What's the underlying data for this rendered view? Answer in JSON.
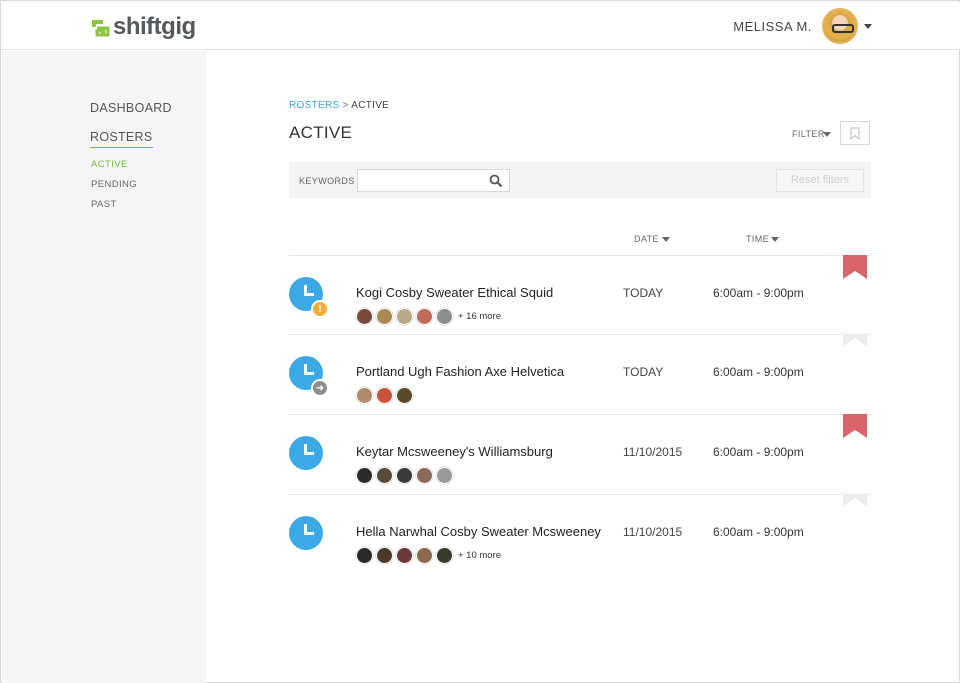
{
  "header": {
    "logo_text": "shiftgig",
    "user_name": "MELISSA M."
  },
  "sidebar": {
    "items": [
      {
        "label": "DASHBOARD"
      },
      {
        "label": "ROSTERS"
      }
    ],
    "sub_items": [
      {
        "label": "ACTIVE",
        "selected": true
      },
      {
        "label": "PENDING",
        "selected": false
      },
      {
        "label": "PAST",
        "selected": false
      }
    ]
  },
  "main": {
    "breadcrumb": {
      "link": "ROSTERS",
      "separator": ">",
      "current": "ACTIVE"
    },
    "title": "ACTIVE",
    "filter_label": "FILTER",
    "keywords_label": "KEYWORDS",
    "keywords_value": "",
    "reset_label": "Reset filters",
    "columns": {
      "date": "DATE",
      "time": "TIME"
    },
    "rows": [
      {
        "title": "Kogi Cosby Sweater Ethical Squid",
        "date": "TODAY",
        "time": "6:00am - 9:00pm",
        "more": "+ 16 more",
        "badge": "warning",
        "badge_glyph": "!",
        "bookmarked": true
      },
      {
        "title": "Portland Ugh Fashion Axe Helvetica",
        "date": "TODAY",
        "time": "6:00am - 9:00pm",
        "more": "",
        "badge": "arrow",
        "badge_glyph": "➜",
        "bookmarked": false
      },
      {
        "title": "Keytar Mcsweeney's Williamsburg",
        "date": "11/10/2015",
        "time": "6:00am - 9:00pm",
        "more": "",
        "badge": "none",
        "badge_glyph": "",
        "bookmarked": true
      },
      {
        "title": "Hella Narwhal Cosby Sweater Mcsweeney",
        "date": "11/10/2015",
        "time": "6:00am - 9:00pm",
        "more": "+ 10 more",
        "badge": "none",
        "badge_glyph": "",
        "bookmarked": false
      }
    ]
  },
  "colors": {
    "brand_green": "#6cbf3f",
    "link_blue": "#3aa6e0",
    "clock_blue": "#3aa9e6",
    "flag_red": "#d9656b",
    "flag_grey": "#ececec",
    "warning_orange": "#f2ad3a"
  }
}
